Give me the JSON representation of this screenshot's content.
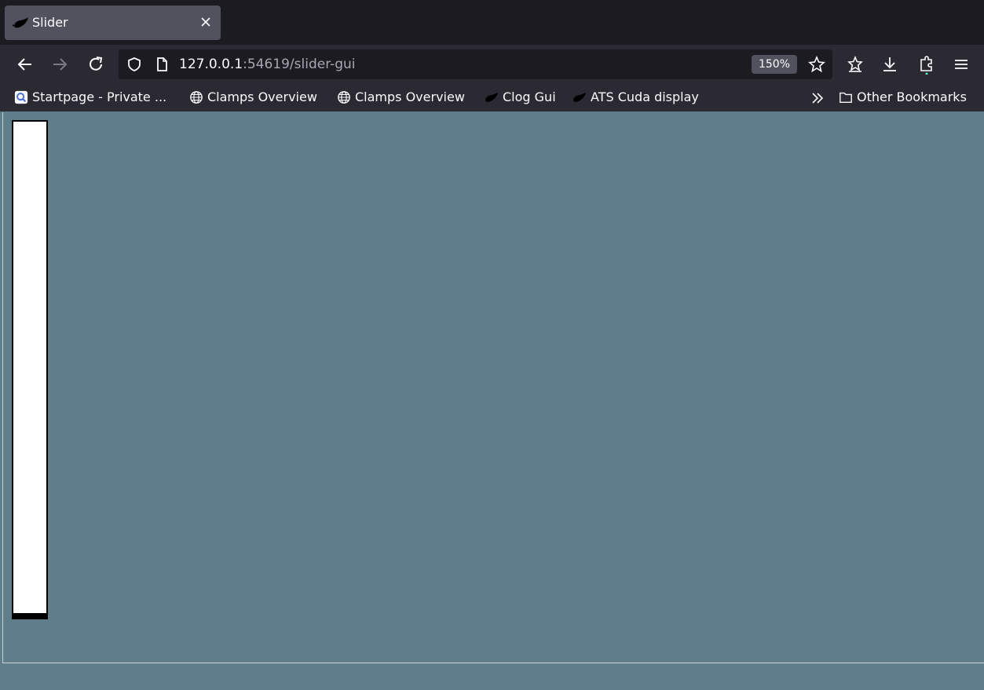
{
  "browser": {
    "tab": {
      "title": "Slider",
      "favicon": "clog-icon"
    },
    "nav": {
      "back": "arrow-left-icon",
      "forward": "arrow-right-icon",
      "reload": "reload-icon"
    },
    "urlbar": {
      "host": "127.0.0.1",
      "rest": ":54619/slider-gui",
      "zoom": "150%"
    },
    "bookmarks": [
      {
        "label": "Startpage - Private ...",
        "icon": "startpage-icon"
      },
      {
        "label": "Clamps Overview",
        "icon": "globe-icon"
      },
      {
        "label": "Clamps Overview",
        "icon": "globe-icon"
      },
      {
        "label": "Clog Gui",
        "icon": "clog-icon"
      },
      {
        "label": "ATS Cuda display",
        "icon": "clog-icon"
      }
    ],
    "other_bookmarks": "Other Bookmarks"
  },
  "page": {
    "slider": {
      "value": 0.01
    }
  },
  "colors": {
    "page_bg": "#607d8b",
    "slider_bg": "#ffffff",
    "slider_fill": "#000000"
  }
}
